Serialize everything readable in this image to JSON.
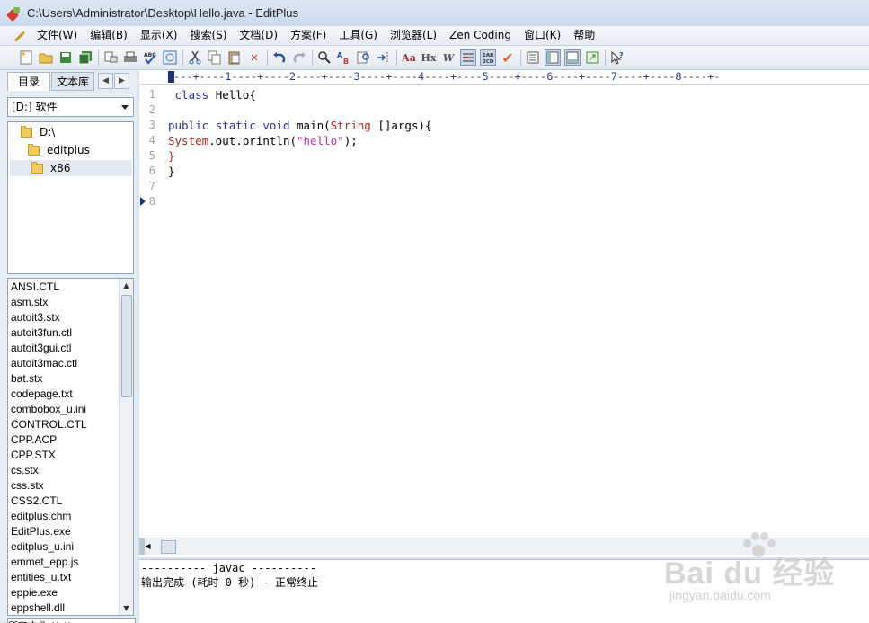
{
  "window": {
    "title": "C:\\Users\\Administrator\\Desktop\\Hello.java - EditPlus"
  },
  "menu": [
    "文件(W)",
    "编辑(B)",
    "显示(X)",
    "搜索(S)",
    "文档(D)",
    "方案(F)",
    "工具(G)",
    "浏览器(L)",
    "Zen Coding",
    "窗口(K)",
    "帮助"
  ],
  "left_panel": {
    "tabs": [
      "目录",
      "文本库"
    ],
    "drive": "[D:] 软件",
    "dirs": [
      "D:\\",
      "editplus",
      "x86"
    ],
    "files": [
      "ANSI.CTL",
      "asm.stx",
      "autoit3.stx",
      "autoit3fun.ctl",
      "autoit3gui.ctl",
      "autoit3mac.ctl",
      "bat.stx",
      "codepage.txt",
      "combobox_u.ini",
      "CONTROL.CTL",
      "CPP.ACP",
      "CPP.STX",
      "cs.stx",
      "css.stx",
      "CSS2.CTL",
      "editplus.chm",
      "EditPlus.exe",
      "editplus_u.ini",
      "emmet_epp.js",
      "entities_u.txt",
      "eppie.exe",
      "eppshell.dll"
    ],
    "file_filter": "所有文件 (*.*)"
  },
  "editor": {
    "ruler": "---+----1----+----2----+----3----+----4----+----5----+----6----+----7----+----8----+-",
    "lines": [
      {
        "n": "1",
        "code": " class Hello{"
      },
      {
        "n": "2",
        "code": ""
      },
      {
        "n": "3",
        "code": "public static void main(String []args){"
      },
      {
        "n": "4",
        "code": "System.out.println(\"hello\");"
      },
      {
        "n": "5",
        "code": "}"
      },
      {
        "n": "6",
        "code": "}"
      },
      {
        "n": "7",
        "code": ""
      },
      {
        "n": "8",
        "code": ""
      }
    ]
  },
  "output": {
    "line1": "---------- javac ----------",
    "line2": "输出完成 (耗时 0 秒) - 正常终止"
  },
  "watermark": {
    "brand": "Bai du 经验",
    "url": "jingyan.baidu.com"
  }
}
